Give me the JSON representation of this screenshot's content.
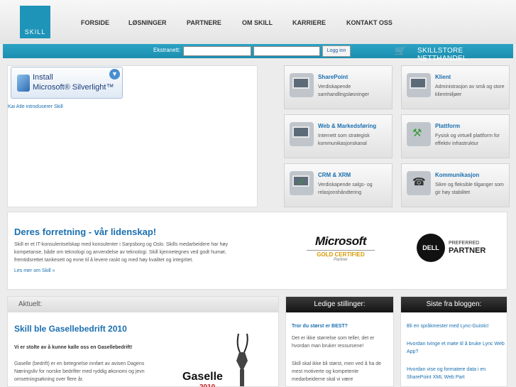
{
  "logo": {
    "text": "SKILL"
  },
  "nav": {
    "items": [
      "FORSIDE",
      "LØSNINGER",
      "PARTNERE",
      "OM SKILL",
      "KARRIERE",
      "KONTAKT OSS"
    ]
  },
  "extranet": {
    "label": "Ekstranett:",
    "login_button": "Logg inn"
  },
  "store": {
    "label": "SKILLSTORE NETTHANDEL",
    "icon": "cart-icon"
  },
  "silverlight": {
    "install": "Install",
    "name": "Microsoft® Silverlight™",
    "caption": "Kai Atle introduserer Skill"
  },
  "services": [
    {
      "title": "SharePoint",
      "desc": "Verdiskapende samhandlingsløsninger",
      "icon": "sharepoint-icon"
    },
    {
      "title": "Klient",
      "desc": "Administrasjon av små og store klientmiljøer",
      "icon": "client-pc-icon"
    },
    {
      "title": "Web & Markedsføring",
      "desc": "Internett som strategisk kommunikasjonskanal",
      "icon": "web-marketing-icon"
    },
    {
      "title": "Plattform",
      "desc": "Fysisk og virtuell plattform for effektiv infrastruktur",
      "icon": "platform-tools-icon"
    },
    {
      "title": "CRM & XRM",
      "desc": "Verdiskapende salgs- og relasjonshåndtering",
      "icon": "crm-check-icon"
    },
    {
      "title": "Kommunikasjon",
      "desc": "Sikre og fleksible tilganger som gir høy stabilitet",
      "icon": "communication-phone-icon"
    }
  ],
  "mission": {
    "heading": "Deres forretning - vår lidenskap!",
    "body": "Skill er et IT-konsulentselskap med konsulenter i Sarpsborg og Oslo. Skills medarbeidere har høy kompetanse, både om teknologi og anvendelse av teknologi. Skill kjennetegnes ved godt humør, fremtidsrettet tankesett og evne til å levere raskt og med høy kvalitet og integritet.",
    "read_more": "Les mer om Skill »"
  },
  "partners": {
    "microsoft": {
      "word": "Microsoft",
      "cert": "GOLD CERTIFIED",
      "partner": "Partner"
    },
    "dell": {
      "logo": "DELL",
      "preferred": "PREFERRED",
      "partner": "PARTNER"
    }
  },
  "news": {
    "header": "Aktuelt:",
    "title": "Skill ble Gasellebedrift 2010",
    "lead": "Vi er stolte av å kunne kalle oss en Gasellebedrift!",
    "body": "Gaselle (bedrift) er en betegnelse innført av avisen Dagens Næringsliv for norske bedrifter med ryddig økonomi og jevn omsetningsøkning over flere år.",
    "image_word": "Gaselle",
    "image_year": "2010"
  },
  "jobs": {
    "header": "Ledige stillinger:",
    "title": "Tror du størst er BEST?",
    "p1": "Det er ikke størrelse som teller, det er hvordan man bruker ressursene!",
    "p2": "Skill skal ikke bli størst, men ved å ha de mest motiverte og kompetente medarbeiderne skal vi være"
  },
  "blog": {
    "header": "Siste fra bloggen:",
    "posts": [
      "Bli en språkmester med Lync-Guistic!",
      "Hvordan tvinge et møte til å bruke Lync Web App?",
      "Hvordan vise og formatere data i en SharePoint XML Web Part"
    ]
  },
  "colors": {
    "accent": "#1a6fb0",
    "bar": "#1d8fb0",
    "logo_bg": "#1e94b8"
  }
}
